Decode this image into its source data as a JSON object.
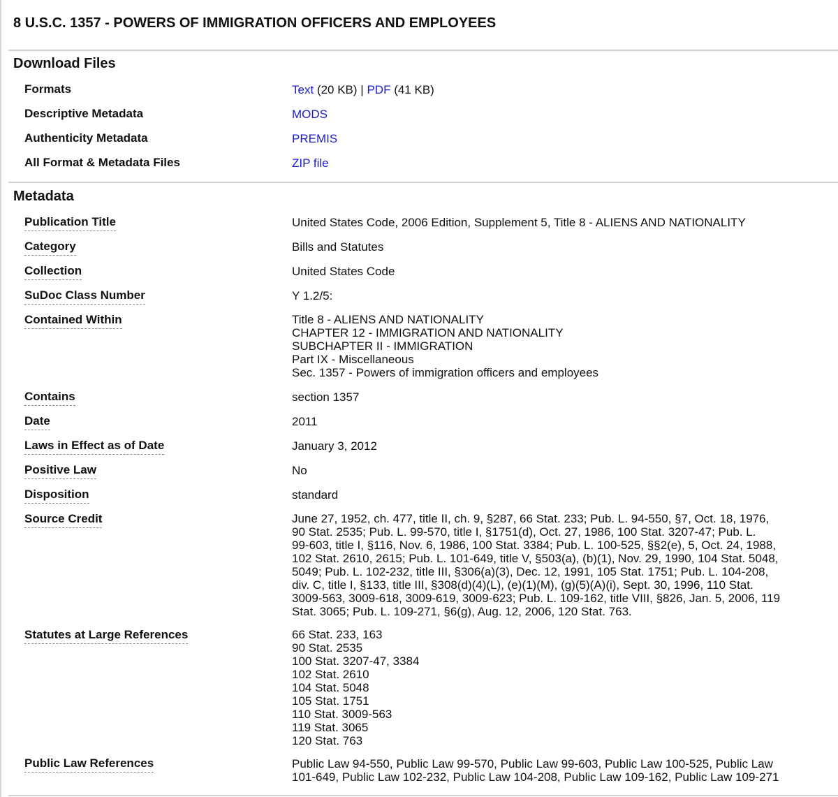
{
  "page": {
    "title": "8 U.S.C. 1357 - POWERS OF IMMIGRATION OFFICERS AND EMPLOYEES"
  },
  "download_files": {
    "heading": "Download Files",
    "rows": {
      "formats": {
        "label": "Formats",
        "text_link": "Text",
        "text_size": "(20 KB)",
        "separator": "|",
        "pdf_link": "PDF",
        "pdf_size": "(41 KB)"
      },
      "descriptive": {
        "label": "Descriptive Metadata",
        "link": "MODS"
      },
      "authenticity": {
        "label": "Authenticity Metadata",
        "link": "PREMIS"
      },
      "all_files": {
        "label": "All Format & Metadata Files",
        "link": "ZIP file"
      }
    }
  },
  "metadata": {
    "heading": "Metadata",
    "publication_title": {
      "label": "Publication Title",
      "value": "United States Code, 2006 Edition, Supplement 5, Title 8 - ALIENS AND NATIONALITY"
    },
    "category": {
      "label": "Category",
      "value": "Bills and Statutes"
    },
    "collection": {
      "label": "Collection",
      "value": "United States Code"
    },
    "sudoc": {
      "label": "SuDoc Class Number",
      "value": "Y 1.2/5:"
    },
    "contained_within": {
      "label": "Contained Within",
      "lines": [
        "Title 8 - ALIENS AND NATIONALITY",
        "CHAPTER 12 - IMMIGRATION AND NATIONALITY",
        "SUBCHAPTER II - IMMIGRATION",
        "Part IX - Miscellaneous",
        "Sec. 1357 - Powers of immigration officers and employees"
      ]
    },
    "contains": {
      "label": "Contains",
      "value": "section 1357"
    },
    "date": {
      "label": "Date",
      "value": "2011"
    },
    "laws_in_effect": {
      "label": "Laws in Effect as of Date",
      "value": "January 3, 2012"
    },
    "positive_law": {
      "label": "Positive Law",
      "value": "No"
    },
    "disposition": {
      "label": "Disposition",
      "value": "standard"
    },
    "source_credit": {
      "label": "Source Credit",
      "lines": [
        "June 27, 1952, ch. 477, title II, ch. 9, §287, 66 Stat. 233; Pub. L. 94-550, §7, Oct. 18, 1976,",
        "90 Stat. 2535; Pub. L. 99-570, title I, §1751(d), Oct. 27, 1986, 100 Stat. 3207-47; Pub. L.",
        "99-603, title I, §116, Nov. 6, 1986, 100 Stat. 3384; Pub. L. 100-525, §§2(e), 5, Oct. 24, 1988,",
        "102 Stat. 2610, 2615; Pub. L. 101-649, title V, §503(a), (b)(1), Nov. 29, 1990, 104 Stat. 5048,",
        "5049; Pub. L. 102-232, title III, §306(a)(3), Dec. 12, 1991, 105 Stat. 1751; Pub. L. 104-208,",
        "div. C, title I, §133, title III, §308(d)(4)(L), (e)(1)(M), (g)(5)(A)(i), Sept. 30, 1996, 110 Stat.",
        "3009-563, 3009-618, 3009-619, 3009-623; Pub. L. 109-162, title VIII, §826, Jan. 5, 2006, 119",
        "Stat. 3065; Pub. L. 109-271, §6(g), Aug. 12, 2006, 120 Stat. 763."
      ]
    },
    "statutes_at_large": {
      "label": "Statutes at Large References",
      "lines": [
        "66 Stat. 233, 163",
        "90 Stat. 2535",
        "100 Stat. 3207-47, 3384",
        "102 Stat. 2610",
        "104 Stat. 5048",
        "105 Stat. 1751",
        "110 Stat. 3009-563",
        "119 Stat. 3065",
        "120 Stat. 763"
      ]
    },
    "public_law_references": {
      "label": "Public Law References",
      "lines": [
        "Public Law 94-550, Public Law 99-570, Public Law 99-603, Public Law 100-525, Public Law",
        "101-649, Public Law 102-232, Public Law 104-208, Public Law 109-162, Public Law 109-271"
      ]
    }
  }
}
